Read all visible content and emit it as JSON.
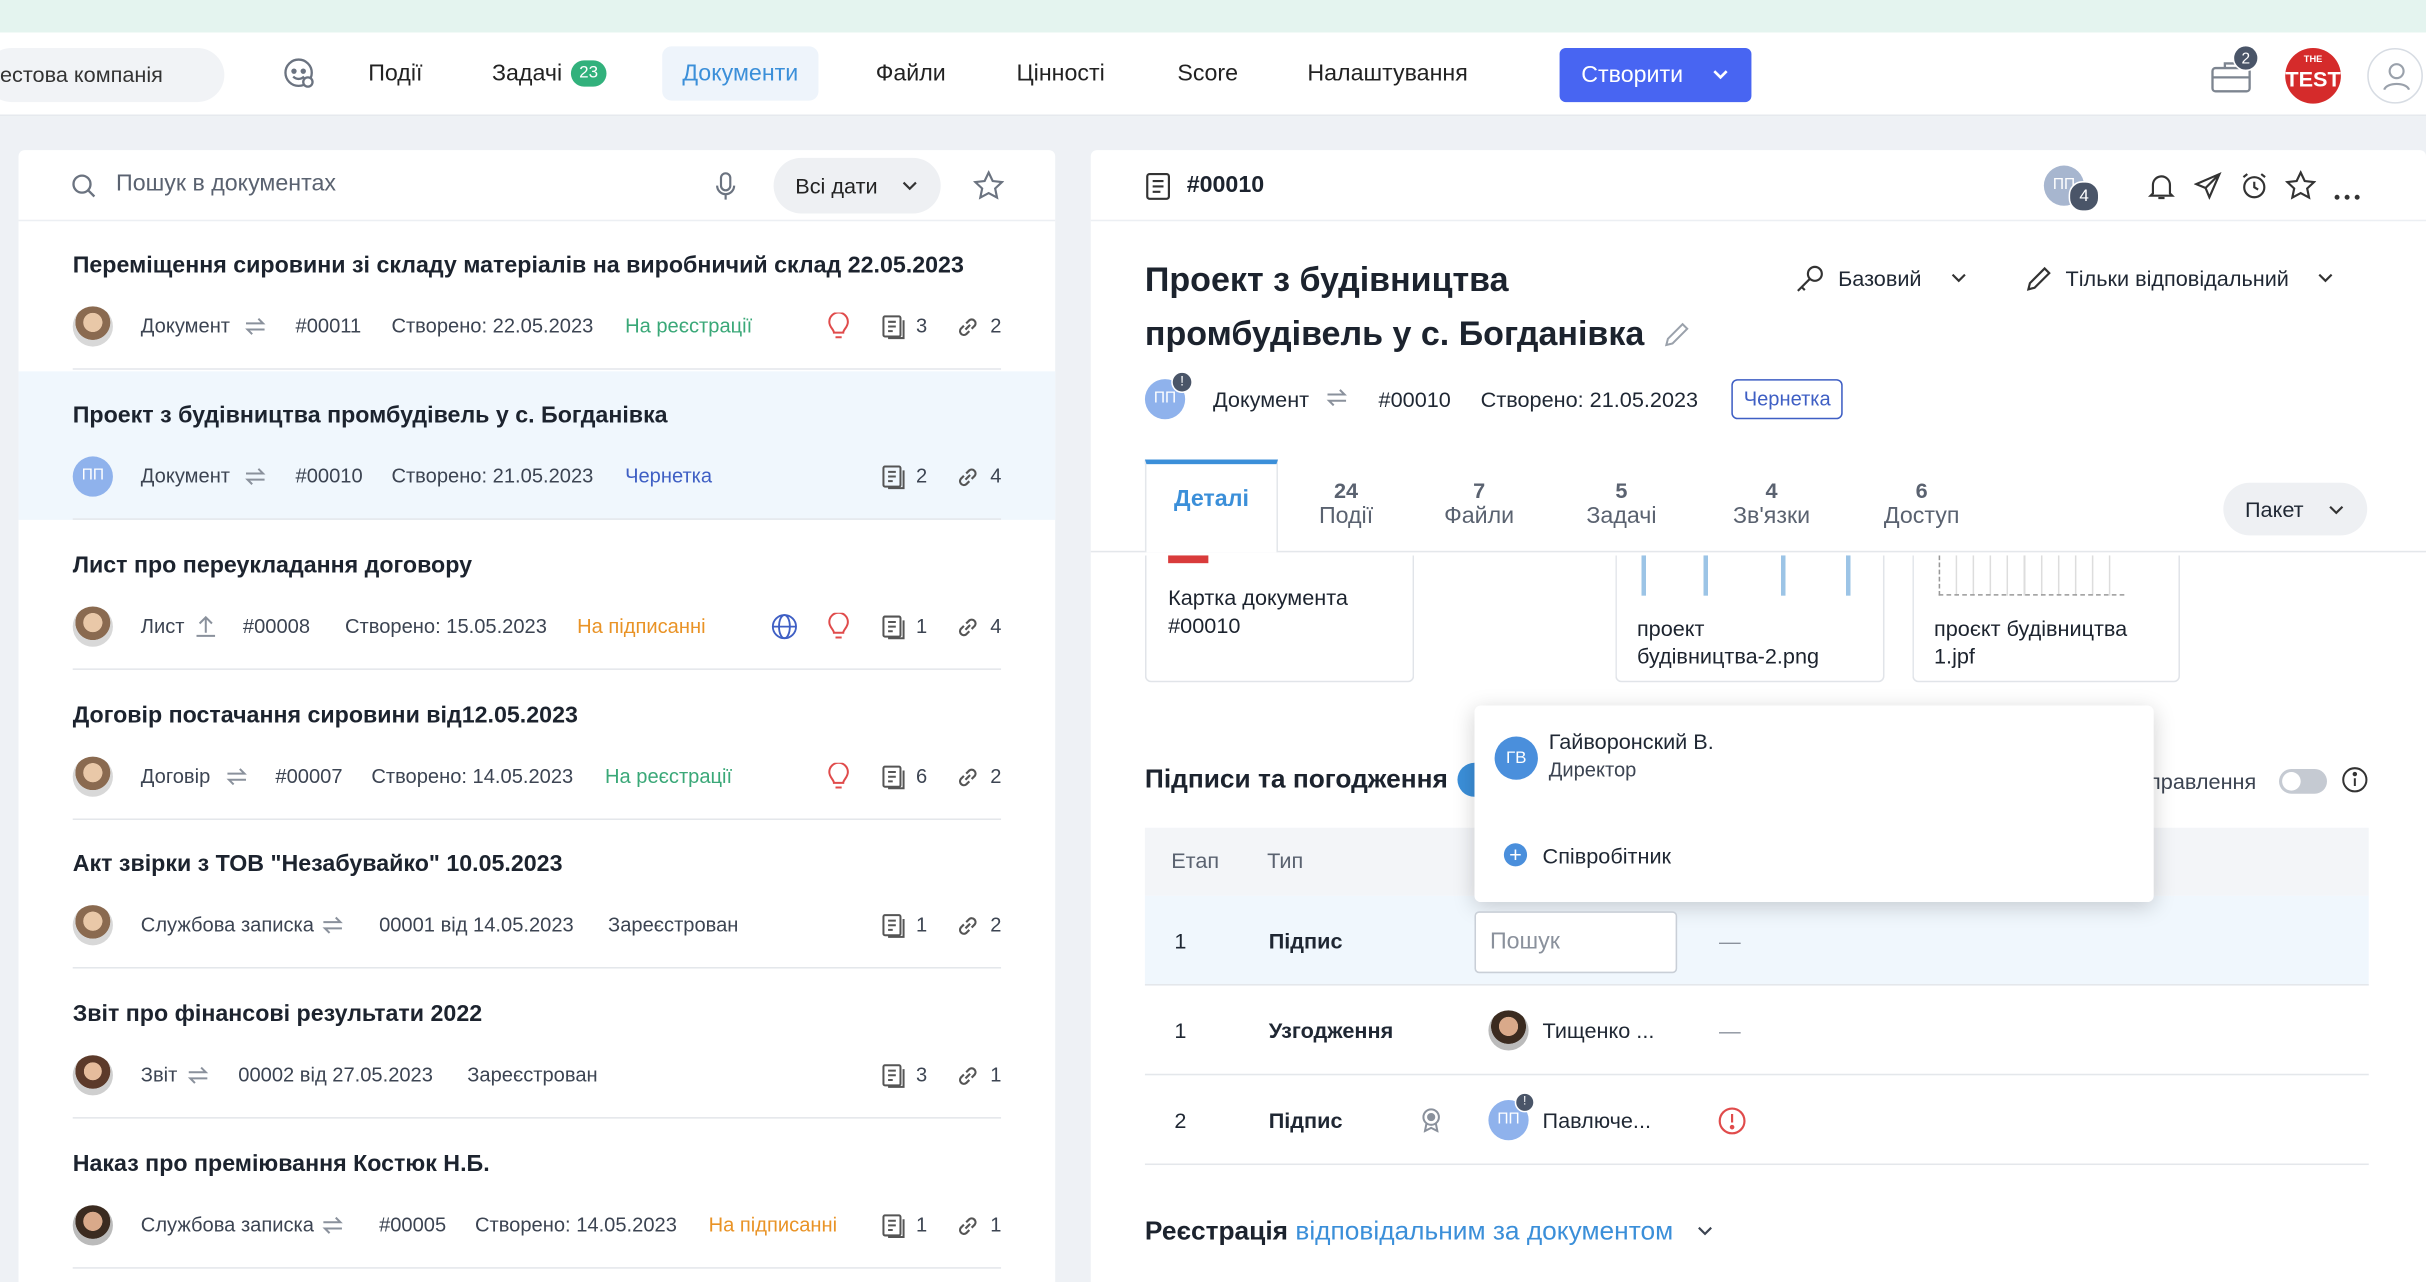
{
  "navbar": {
    "company": "естова компанія",
    "items": [
      {
        "label": "Події"
      },
      {
        "label": "Задачі",
        "badge": "23"
      },
      {
        "label": "Документи"
      },
      {
        "label": "Файли"
      },
      {
        "label": "Цінності"
      },
      {
        "label": "Score"
      },
      {
        "label": "Налаштування"
      }
    ],
    "create_label": "Створити",
    "briefcase_count": "2",
    "logo_top": "THE",
    "logo_main": "TEST"
  },
  "left": {
    "search_placeholder": "Пошук в документах",
    "dates_label": "Всі дати",
    "documents": [
      {
        "title": "Переміщення сировини зі складу матеріалів на виробничий склад 22.05.2023",
        "type": "Документ",
        "number": "#00011",
        "created": "Створено: 22.05.2023",
        "status": "На реєстрації",
        "files": "3",
        "links": "2"
      },
      {
        "title": "Проект з будівництва промбудівель у с. Богданівка",
        "avatar": "ПП",
        "type": "Документ",
        "number": "#00010",
        "created": "Створено: 21.05.2023",
        "status": "Чернетка",
        "files": "2",
        "links": "4"
      },
      {
        "title": "Лист про переукладання договору",
        "type": "Лист",
        "number": "#00008",
        "created": "Створено: 15.05.2023",
        "status": "На підписанні",
        "files": "1",
        "links": "4"
      },
      {
        "title": "Договір постачання сировини від12.05.2023",
        "type": "Договір",
        "number": "#00007",
        "created": "Створено: 14.05.2023",
        "status": "На реєстрації",
        "files": "6",
        "links": "2"
      },
      {
        "title": "Акт звірки з ТОВ \"Незабувайко\" 10.05.2023",
        "type": "Службова записка",
        "number": "00001 від 14.05.2023",
        "status": "Зареєстрован",
        "files": "1",
        "links": "2"
      },
      {
        "title": "Звіт про фінансові результати 2022",
        "type": "Звіт",
        "number": "00002 від 27.05.2023",
        "status": "Зареєстрован",
        "files": "3",
        "links": "1"
      },
      {
        "title": "Наказ про преміювання Костюк Н.Б.",
        "type": "Службова записка",
        "number": "#00005",
        "created": "Створено: 14.05.2023",
        "status": "На підписанні",
        "files": "1",
        "links": "1"
      }
    ]
  },
  "right": {
    "doc_number": "#00010",
    "participants_initials": "ПП",
    "participants_count": "4",
    "title": "Проект з будівництва промбудівель у с. Богданівка",
    "access_label": "Базовий",
    "edit_label": "Тільки відповідальний",
    "avatar": "ПП",
    "type": "Документ",
    "number": "#00010",
    "created": "Створено: 21.05.2023",
    "status": "Чернетка",
    "tabs": [
      {
        "count": "",
        "label": "Деталі"
      },
      {
        "count": "24",
        "label": "Події"
      },
      {
        "count": "7",
        "label": "Файли"
      },
      {
        "count": "5",
        "label": "Задачі"
      },
      {
        "count": "4",
        "label": "Зв'язки"
      },
      {
        "count": "6",
        "label": "Доступ"
      }
    ],
    "package_label": "Пакет",
    "cards": [
      {
        "line1": "Картка документа",
        "line2": "#00010"
      },
      {
        "line1": "проект",
        "line2": "будівництва-2.png"
      },
      {
        "line1": "проєкт будівництва",
        "line2": "1.jpf"
      }
    ],
    "signatures_title": "Підписи та погодження",
    "routing_label": "правлення",
    "table_headers": [
      "Етап",
      "Тип"
    ],
    "rows": [
      {
        "stage": "1",
        "type": "Підпис",
        "search_placeholder": "Пошук",
        "dash": "—"
      },
      {
        "stage": "1",
        "type": "Узгодження",
        "person": "Тищенко ...",
        "dash": "—"
      },
      {
        "stage": "2",
        "type": "Підпис",
        "avatar": "ПП",
        "person": "Павлюче..."
      }
    ],
    "registration_title": "Реєстрація",
    "registration_link": "відповідальним за документом"
  },
  "popup": {
    "person_initials": "ГВ",
    "person_name": "Гайворонский В.",
    "person_role": "Директор",
    "add_label": "Співробітник"
  }
}
